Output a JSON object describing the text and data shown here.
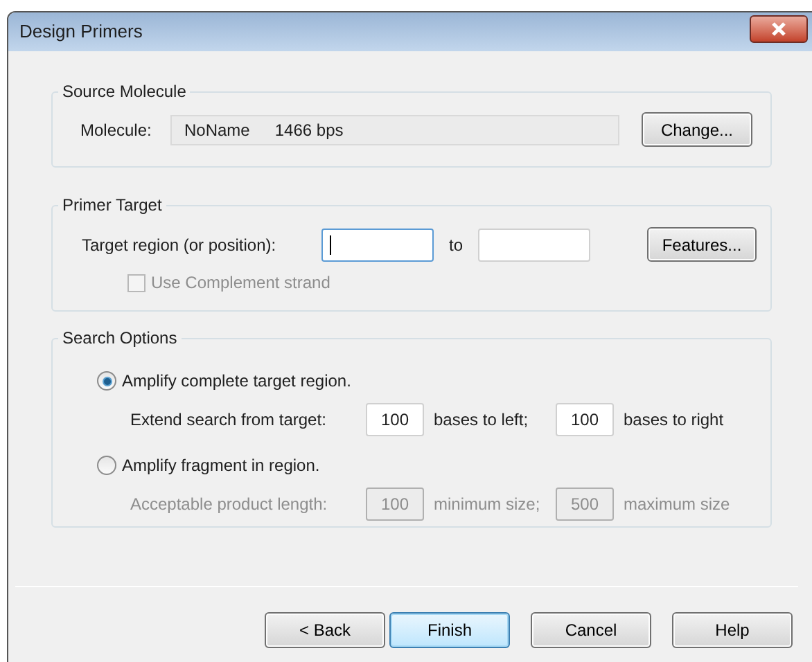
{
  "window": {
    "title": "Design Primers"
  },
  "source_molecule": {
    "title": "Source Molecule",
    "label": "Molecule:",
    "name": "NoName",
    "size": "1466 bps",
    "button": "Change..."
  },
  "primer_target": {
    "title": "Primer Target",
    "label": "Target region (or position):",
    "from_focused": true,
    "to": "to",
    "button": "Features...",
    "complement": {
      "label": "Use Complement strand",
      "checked": false,
      "disabled": true
    }
  },
  "search_options": {
    "title": "Search Options",
    "options": [
      {
        "label": "Amplify complete target region.",
        "selected": true,
        "row": {
          "label": "Extend search from target:",
          "disabled": false,
          "inputs": [
            {
              "value": "100",
              "unit": "bases to left;"
            },
            {
              "value": "100",
              "unit": "bases to right"
            }
          ]
        }
      },
      {
        "label": "Amplify fragment in region.",
        "selected": false,
        "row": {
          "label": "Acceptable product length:",
          "disabled": true,
          "inputs": [
            {
              "value": "100",
              "unit": "minimum size;"
            },
            {
              "value": "500",
              "unit": "maximum size"
            }
          ]
        }
      }
    ]
  },
  "buttons": [
    {
      "label": "< Back",
      "default": false
    },
    {
      "label": "Finish",
      "default": true
    },
    {
      "label": "Cancel",
      "default": false
    },
    {
      "label": "Help",
      "default": false
    }
  ]
}
